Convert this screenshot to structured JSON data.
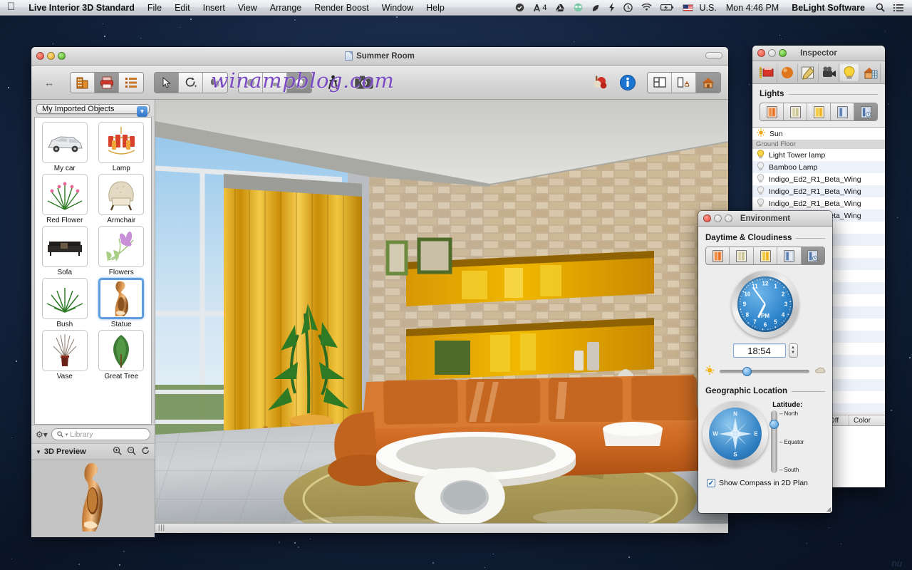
{
  "menubar": {
    "apple": "",
    "app_name": "Live Interior 3D Standard",
    "menus": [
      "File",
      "Edit",
      "Insert",
      "View",
      "Arrange",
      "Render Boost",
      "Window",
      "Help"
    ],
    "status_icons": [
      "check-circle-icon",
      "adobe-icon",
      "google-drive-icon",
      "dropbox-icon",
      "evernote-icon",
      "flash-icon",
      "clock-icon",
      "wifi-icon",
      "battery-icon"
    ],
    "adobe_badge": "4",
    "input_source": "U.S.",
    "clock": "Mon 4:46 PM",
    "user": "BeLight Software",
    "spotlight": "search-icon",
    "notification_center": "list-icon"
  },
  "main_window": {
    "title": "Summer Room",
    "watermark": "winampblog.com",
    "toolbar": {
      "resize_label": "resize-arrows-icon",
      "view_group": [
        "building-icon",
        "printer-icon",
        "list-detail-icon"
      ],
      "tool_group": [
        "arrow-select-icon",
        "rotate-icon",
        "walk-feet-icon"
      ],
      "shade_group": [
        "flat-shade-icon",
        "smooth-shade-icon",
        "glossy-shade-icon"
      ],
      "walk_icon": "walk-person-icon",
      "camera_icon": "camera-icon",
      "render_icon": "render-truck-icon",
      "info_icon": "info-icon",
      "layout_group": [
        "2d-plan-icon",
        "split-view-icon",
        "3d-view-icon"
      ]
    }
  },
  "library": {
    "popup_label": "My Imported Objects",
    "objects": [
      {
        "label": "My car",
        "icon": "car-thumb",
        "selected": false
      },
      {
        "label": "Lamp",
        "icon": "chandelier-thumb",
        "selected": false
      },
      {
        "label": "Red Flower",
        "icon": "red-flower-thumb",
        "selected": false
      },
      {
        "label": "Armchair",
        "icon": "armchair-thumb",
        "selected": false
      },
      {
        "label": "Sofa",
        "icon": "sofa-thumb",
        "selected": false
      },
      {
        "label": "Flowers",
        "icon": "flowers-thumb",
        "selected": false
      },
      {
        "label": "Bush",
        "icon": "bush-thumb",
        "selected": false
      },
      {
        "label": "Statue",
        "icon": "statue-thumb",
        "selected": true
      },
      {
        "label": "Vase",
        "icon": "vase-thumb",
        "selected": false
      },
      {
        "label": "Great Tree",
        "icon": "great-tree-thumb",
        "selected": false
      }
    ],
    "gear_label": "gear-icon",
    "search_placeholder": "Library",
    "preview_title": "3D Preview",
    "preview_tools": [
      "zoom-in-icon",
      "zoom-out-icon",
      "rotate-refresh-icon"
    ]
  },
  "inspector": {
    "title": "Inspector",
    "tabs": [
      "object-tab",
      "material-tab",
      "edit-tab",
      "camera-tab",
      "light-tab",
      "building-tab"
    ],
    "active_tab_index": 4,
    "section_title": "Lights",
    "preset_count": 5,
    "active_preset_index": 4,
    "lights": [
      {
        "name": "Sun",
        "icon": "sun-icon",
        "group": false,
        "on": true
      },
      {
        "name": "Ground Floor",
        "group": true
      },
      {
        "name": "Light Tower lamp",
        "icon": "bulb-on-icon",
        "group": false,
        "on": true
      },
      {
        "name": "Bamboo Lamp",
        "icon": "bulb-off-icon",
        "group": false,
        "on": false
      },
      {
        "name": "Indigo_Ed2_R1_Beta_Wing",
        "icon": "bulb-off-icon",
        "group": false,
        "on": false
      },
      {
        "name": "Indigo_Ed2_R1_Beta_Wing",
        "icon": "bulb-off-icon",
        "group": false,
        "on": false
      },
      {
        "name": "Indigo_Ed2_R1_Beta_Wing",
        "icon": "bulb-off-icon",
        "group": false,
        "on": false
      },
      {
        "name": "Indigo_Ed2_R1_Beta_Wing",
        "icon": "bulb-off-icon",
        "group": false,
        "on": false
      }
    ],
    "table_headers": [
      "On|Off",
      "Color"
    ],
    "color_rows": [
      {
        "bulb": "bulb-on-icon",
        "color": "#ffffff"
      },
      {
        "bulb": "bulb-off-icon",
        "color": "#ffffff"
      },
      {
        "bulb": "bulb-on-icon",
        "color": "#ffffff"
      }
    ]
  },
  "environment": {
    "title": "Environment",
    "daytime_section": "Daytime & Cloudiness",
    "preset_count": 5,
    "active_preset_index": 4,
    "clock": {
      "numbers": [
        "12",
        "1",
        "2",
        "3",
        "4",
        "5",
        "6",
        "7",
        "8",
        "9",
        "10",
        "11"
      ],
      "meridiem": "PM",
      "hour_angle": 207,
      "minute_angle": 324
    },
    "time_value": "18:54",
    "stepper": "stepper-icon",
    "cloudiness": {
      "sun_icon": "sun-small-icon",
      "cloud_icon": "cloud-small-icon",
      "value_percent": 30
    },
    "geo_section": "Geographic Location",
    "compass": {
      "directions": [
        "N",
        "E",
        "S",
        "W"
      ]
    },
    "latitude_label": "Latitude:",
    "latitude_ticks": [
      "North",
      "Equator",
      "South"
    ],
    "latitude_value_percent": 22,
    "checkbox": {
      "label": "Show Compass in 2D Plan",
      "checked": true
    }
  },
  "colors": {
    "accent_blue": "#3a8fd4",
    "selection_blue": "#5d9ee0",
    "watermark_purple": "#7b4bc4",
    "curtain_gold": "#e8a705",
    "sofa_orange": "#d4631c",
    "stone_tan": "#c9b596"
  }
}
